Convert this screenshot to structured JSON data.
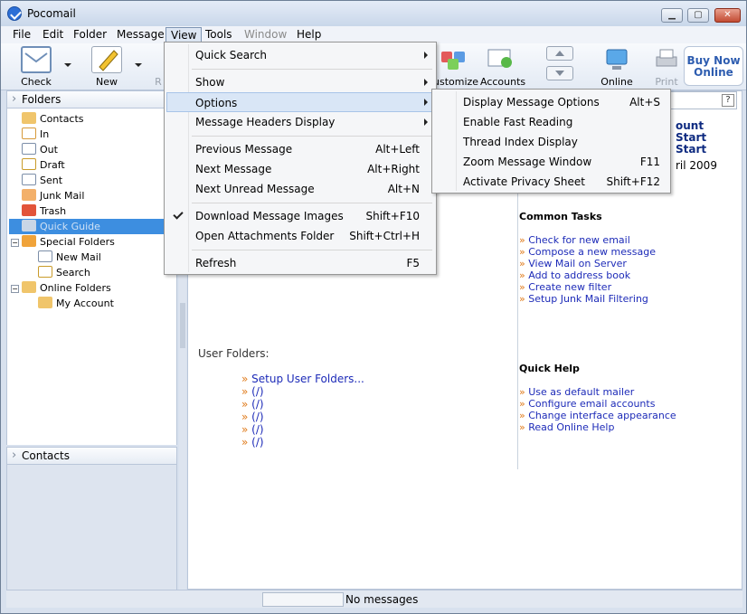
{
  "window": {
    "title": "Pocomail",
    "controls": {
      "minimize": "▁",
      "maximize": "▢",
      "close": "✕"
    }
  },
  "menubar": {
    "items": [
      "File",
      "Edit",
      "Folder",
      "Message",
      "View",
      "Tools",
      "Window",
      "Help"
    ],
    "active": "View",
    "disabled": [
      "Window"
    ]
  },
  "toolbar": {
    "check": "Check",
    "new": "New",
    "reply": "R",
    "customize": "ustomize",
    "accounts": "Accounts",
    "online": "Online",
    "print": "Print",
    "buy_now_line1": "Buy Now",
    "buy_now_line2": "Online"
  },
  "folders": {
    "header": "Folders",
    "items": [
      {
        "label": "Contacts",
        "icon": "contacts-icon"
      },
      {
        "label": "In",
        "icon": "inbox-icon"
      },
      {
        "label": "Out",
        "icon": "outbox-icon"
      },
      {
        "label": "Draft",
        "icon": "draft-icon"
      },
      {
        "label": "Sent",
        "icon": "sent-icon"
      },
      {
        "label": "Junk Mail",
        "icon": "junk-mail-icon"
      },
      {
        "label": "Trash",
        "icon": "trash-icon"
      },
      {
        "label": "Quick Guide",
        "icon": "quick-guide-icon"
      },
      {
        "label": "Special Folders",
        "icon": "special-folders-icon"
      },
      {
        "label": "New Mail",
        "icon": "new-mail-icon"
      },
      {
        "label": "Search",
        "icon": "search-folder-icon"
      },
      {
        "label": "Online Folders",
        "icon": "online-folders-icon"
      },
      {
        "label": "My Account",
        "icon": "account-folder-icon"
      }
    ]
  },
  "contacts_panel": {
    "header": "Contacts"
  },
  "main": {
    "right_top": [
      "ount",
      "Start",
      "Start"
    ],
    "date": "ril 2009",
    "common_tasks": {
      "title": "Common Tasks",
      "links": [
        "Check for new email",
        "Compose a new message",
        "View Mail on Server",
        "Add to address book",
        "Create new filter",
        "Setup Junk Mail Filtering"
      ]
    },
    "quick_help": {
      "title": "Quick Help",
      "links": [
        "Use as default mailer",
        "Configure email accounts",
        "Change interface appearance",
        "Read Online Help"
      ]
    },
    "user_folders": {
      "title": "User Folders:",
      "links": [
        "Setup User Folders...",
        "(/)",
        "(/)",
        "(/)",
        "(/)",
        "(/)"
      ]
    },
    "help_button": "?",
    "arrow_glyph": "»"
  },
  "view_menu": {
    "items": [
      {
        "label": "Quick Search",
        "shortcut": "",
        "submenu": true
      },
      {
        "label": "Show",
        "shortcut": "",
        "submenu": true
      },
      {
        "label": "Options",
        "shortcut": "",
        "submenu": true,
        "highlight": true
      },
      {
        "label": "Message Headers Display",
        "shortcut": "",
        "submenu": true
      },
      {
        "label": "Previous Message",
        "shortcut": "Alt+Left"
      },
      {
        "label": "Next Message",
        "shortcut": "Alt+Right"
      },
      {
        "label": "Next Unread Message",
        "shortcut": "Alt+N"
      },
      {
        "label": "Download Message Images",
        "shortcut": "Shift+F10",
        "checked": true
      },
      {
        "label": "Open Attachments Folder",
        "shortcut": "Shift+Ctrl+H"
      },
      {
        "label": "Refresh",
        "shortcut": "F5"
      }
    ]
  },
  "options_submenu": {
    "items": [
      {
        "label": "Display Message Options",
        "shortcut": "Alt+S"
      },
      {
        "label": "Enable Fast Reading",
        "shortcut": ""
      },
      {
        "label": "Thread Index Display",
        "shortcut": ""
      },
      {
        "label": "Zoom Message Window",
        "shortcut": "F11"
      },
      {
        "label": "Activate Privacy Sheet",
        "shortcut": "Shift+F12"
      }
    ]
  },
  "statusbar": {
    "text": "No messages"
  },
  "colors": {
    "accent": "#3d8ee0",
    "link": "#1d2bb8",
    "arrow": "#e07b1b",
    "menu_highlight": "#d9e6f6"
  }
}
